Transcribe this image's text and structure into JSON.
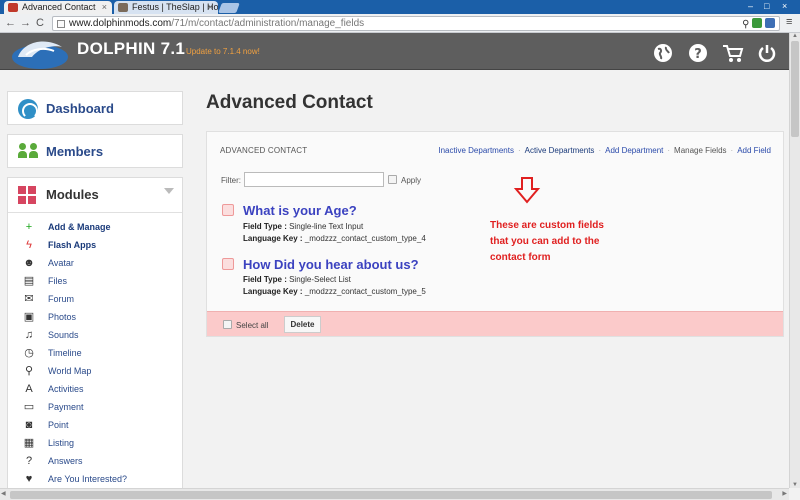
{
  "browser": {
    "tabs": [
      {
        "label": "Advanced Contact"
      },
      {
        "label": "Festus | TheSlap | Ho"
      }
    ],
    "url_host": "www.dolphinmods.com",
    "url_path": "/71/m/contact/administration/manage_fields",
    "tab_close": "×",
    "win_min": "–",
    "win_max": "□",
    "win_close": "×",
    "nav_back": "←",
    "nav_forward": "→",
    "nav_reload": "C",
    "menu": "≡"
  },
  "header": {
    "brand": "DOLPHIN 7.1",
    "update_text": "Update to 7.1.4 now!",
    "icons": [
      "globe-icon",
      "help-icon",
      "cart-icon",
      "power-icon"
    ]
  },
  "sidebar": {
    "dashboard": "Dashboard",
    "members": "Members",
    "modules": "Modules",
    "items": [
      {
        "label": "Add & Manage",
        "icon": "plus-icon",
        "glyph": "+",
        "color": "#1aa61a"
      },
      {
        "label": "Flash Apps",
        "icon": "flash-icon",
        "glyph": "ϟ",
        "color": "#d33"
      },
      {
        "label": "Avatar",
        "icon": "avatar-icon",
        "glyph": "☻",
        "color": "#333"
      },
      {
        "label": "Files",
        "icon": "files-icon",
        "glyph": "▤",
        "color": "#333"
      },
      {
        "label": "Forum",
        "icon": "forum-icon",
        "glyph": "✉",
        "color": "#333"
      },
      {
        "label": "Photos",
        "icon": "photos-icon",
        "glyph": "▣",
        "color": "#333"
      },
      {
        "label": "Sounds",
        "icon": "sounds-icon",
        "glyph": "♫",
        "color": "#333"
      },
      {
        "label": "Timeline",
        "icon": "timeline-icon",
        "glyph": "◷",
        "color": "#333"
      },
      {
        "label": "World Map",
        "icon": "world-map-icon",
        "glyph": "⚲",
        "color": "#333"
      },
      {
        "label": "Activities",
        "icon": "activities-icon",
        "glyph": "A",
        "color": "#333"
      },
      {
        "label": "Payment",
        "icon": "payment-icon",
        "glyph": "▭",
        "color": "#333"
      },
      {
        "label": "Point",
        "icon": "point-icon",
        "glyph": "◙",
        "color": "#333"
      },
      {
        "label": "Listing",
        "icon": "listing-icon",
        "glyph": "▦",
        "color": "#333"
      },
      {
        "label": "Answers",
        "icon": "answers-icon",
        "glyph": "?",
        "color": "#333"
      },
      {
        "label": "Are You Interested?",
        "icon": "heart-icon",
        "glyph": "♥",
        "color": "#333"
      }
    ]
  },
  "main": {
    "title": "Advanced Contact",
    "panel_title": "ADVANCED CONTACT",
    "links": [
      {
        "label": "Inactive Departments",
        "style": "lnk"
      },
      {
        "label": "Active Departments",
        "style": "lnk-active"
      },
      {
        "label": "Add Department",
        "style": "lnk"
      },
      {
        "label": "Manage Fields",
        "style": "lnk-plain"
      },
      {
        "label": "Add Field",
        "style": "lnk"
      }
    ],
    "link_separator": "·",
    "filter_label": "Filter:",
    "filter_value": "",
    "apply_label": "Apply",
    "fields": [
      {
        "title": "What is your Age?",
        "type_label": "Field Type :",
        "type_value": "Single-line Text Input",
        "key_label": "Language Key :",
        "key_value": "_modzzz_contact_custom_type_4"
      },
      {
        "title": "How Did you hear about us?",
        "type_label": "Field Type :",
        "type_value": "Single-Select List",
        "key_label": "Language Key :",
        "key_value": "_modzzz_contact_custom_type_5"
      }
    ],
    "callout_lines": [
      "These are custom fields",
      "that you can add to the",
      "contact form"
    ],
    "select_all": "Select all",
    "delete": "Delete"
  },
  "colors": {
    "accent": "#3b42c0",
    "callout": "#e02020",
    "footer": "#fbcaca"
  }
}
